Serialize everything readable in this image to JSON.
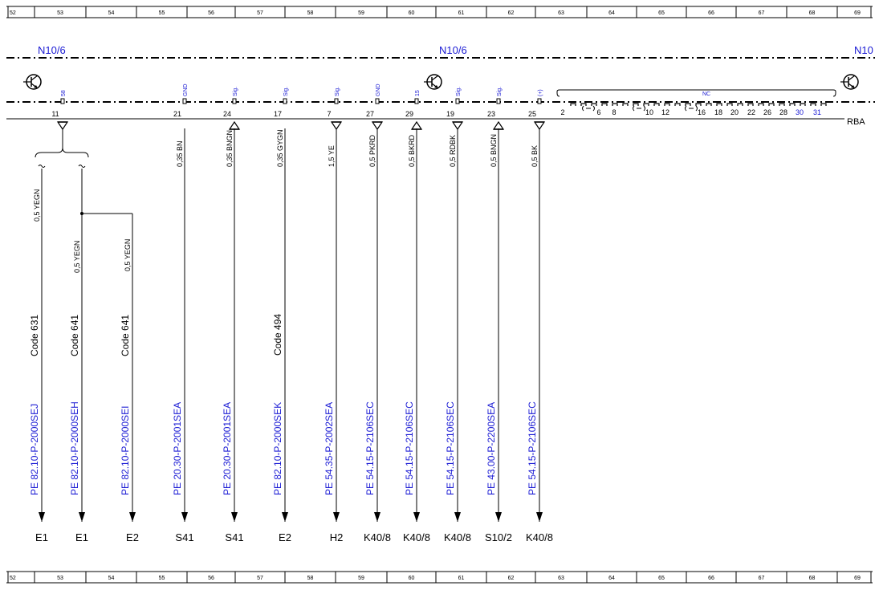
{
  "ruler": {
    "cells": [
      "52",
      "53",
      "54",
      "55",
      "56",
      "57",
      "58",
      "59",
      "60",
      "61",
      "62",
      "63",
      "64",
      "65",
      "66",
      "67",
      "68",
      "69"
    ]
  },
  "component": {
    "name_left": "N10/6",
    "name_center": "N10/6",
    "name_right_partial": "N10",
    "suffix": "RBA"
  },
  "nc_box": {
    "label": "NC",
    "pins": [
      "2",
      "6",
      "8",
      "10",
      "12",
      "16",
      "18",
      "20",
      "22",
      "26",
      "28",
      "30",
      "31"
    ],
    "blue_pins": [
      "30",
      "31"
    ]
  },
  "connectors": [
    {
      "pin": "11",
      "signal": "58",
      "arrow": "out"
    },
    {
      "pin": "21",
      "signal": "GND",
      "arrow": "none",
      "wire": "0,35 BN",
      "ref": "PE 20.30-P-2001SEA",
      "dest": "S41"
    },
    {
      "pin": "24",
      "signal": "Sig.",
      "arrow": "in",
      "wire": "0,35 BNGN",
      "ref": "PE 20.30-P-2001SEA",
      "dest": "S41"
    },
    {
      "pin": "17",
      "signal": "Sig.",
      "arrow": "none",
      "wire": "0,35 GYGN",
      "code": "Code 494",
      "ref": "PE 82.10-P-2000SEK",
      "dest": "E2"
    },
    {
      "pin": "7",
      "signal": "Sig.",
      "arrow": "out",
      "wire": "1,5 YE",
      "ref": "PE 54.35-P-2002SEA",
      "dest": "H2"
    },
    {
      "pin": "27",
      "signal": "GND",
      "arrow": "out",
      "wire": "0,5 PKRD",
      "ref": "PE 54.15-P-2106SEC",
      "dest": "K40/8"
    },
    {
      "pin": "29",
      "signal": "15",
      "arrow": "in",
      "wire": "0,5 BKRD",
      "ref": "PE 54.15-P-2106SEC",
      "dest": "K40/8"
    },
    {
      "pin": "19",
      "signal": "Sig.",
      "arrow": "out",
      "wire": "0,5 RDBK",
      "ref": "PE 54.15-P-2106SEC",
      "dest": "K40/8"
    },
    {
      "pin": "23",
      "signal": "Sig.",
      "arrow": "in",
      "wire": "0,5 BNGN",
      "ref": "PE 43.00-P-2200SEA",
      "dest": "S10/2"
    },
    {
      "pin": "25",
      "signal": "(+)",
      "arrow": "out",
      "wire": "0,5 BK",
      "ref": "PE 54.15-P-2106SEC",
      "dest": "K40/8"
    }
  ],
  "branches": [
    {
      "wire": "0,5 YEGN",
      "code": "Code 631",
      "ref": "PE 82.10-P-2000SEJ",
      "dest": "E1"
    },
    {
      "wire": "0,5 YEGN",
      "code": "Code 641",
      "ref": "PE 82.10-P-2000SEH",
      "dest": "E1"
    },
    {
      "wire": "0,5 YEGN",
      "code": "Code 641",
      "ref": "PE 82.10-P-2000SEI",
      "dest": "E2"
    }
  ],
  "colors": {
    "line": "#000000",
    "blue_text": "#1a1ad4"
  },
  "icons": [
    "transistor-icon",
    "ground-arrow-icon",
    "connector-terminal-icon"
  ]
}
